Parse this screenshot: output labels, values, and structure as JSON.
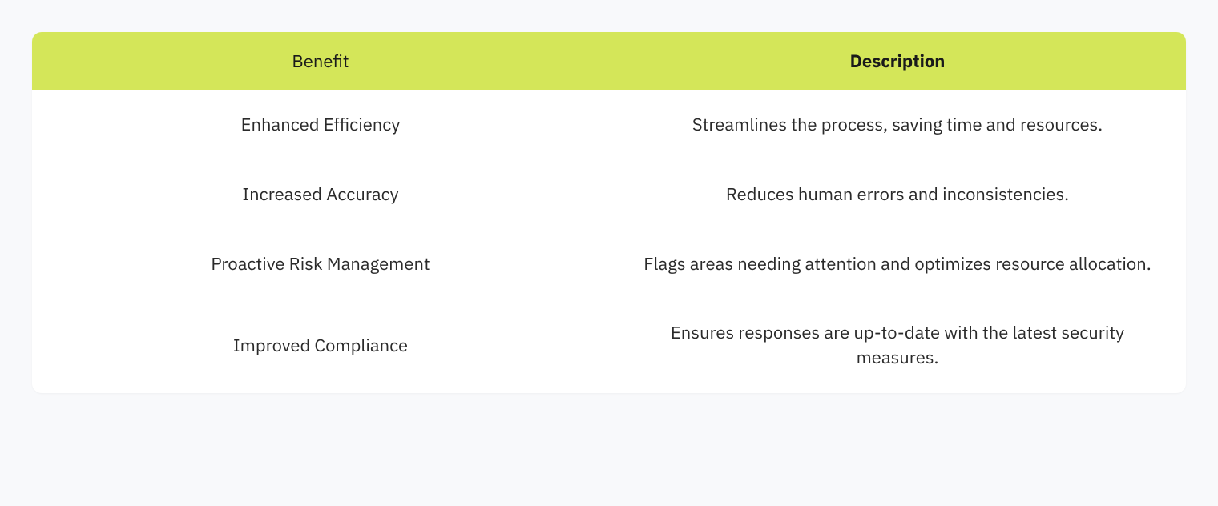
{
  "table": {
    "headers": {
      "benefit": "Benefit",
      "description": "Description"
    },
    "rows": [
      {
        "benefit": "Enhanced Efficiency",
        "description": "Streamlines the process, saving time and resources."
      },
      {
        "benefit": "Increased Accuracy",
        "description": "Reduces human errors and inconsistencies."
      },
      {
        "benefit": "Proactive Risk Management",
        "description": "Flags areas needing attention and optimizes resource allocation."
      },
      {
        "benefit": "Improved Compliance",
        "description": "Ensures responses are up-to-date with the latest security measures."
      }
    ]
  }
}
